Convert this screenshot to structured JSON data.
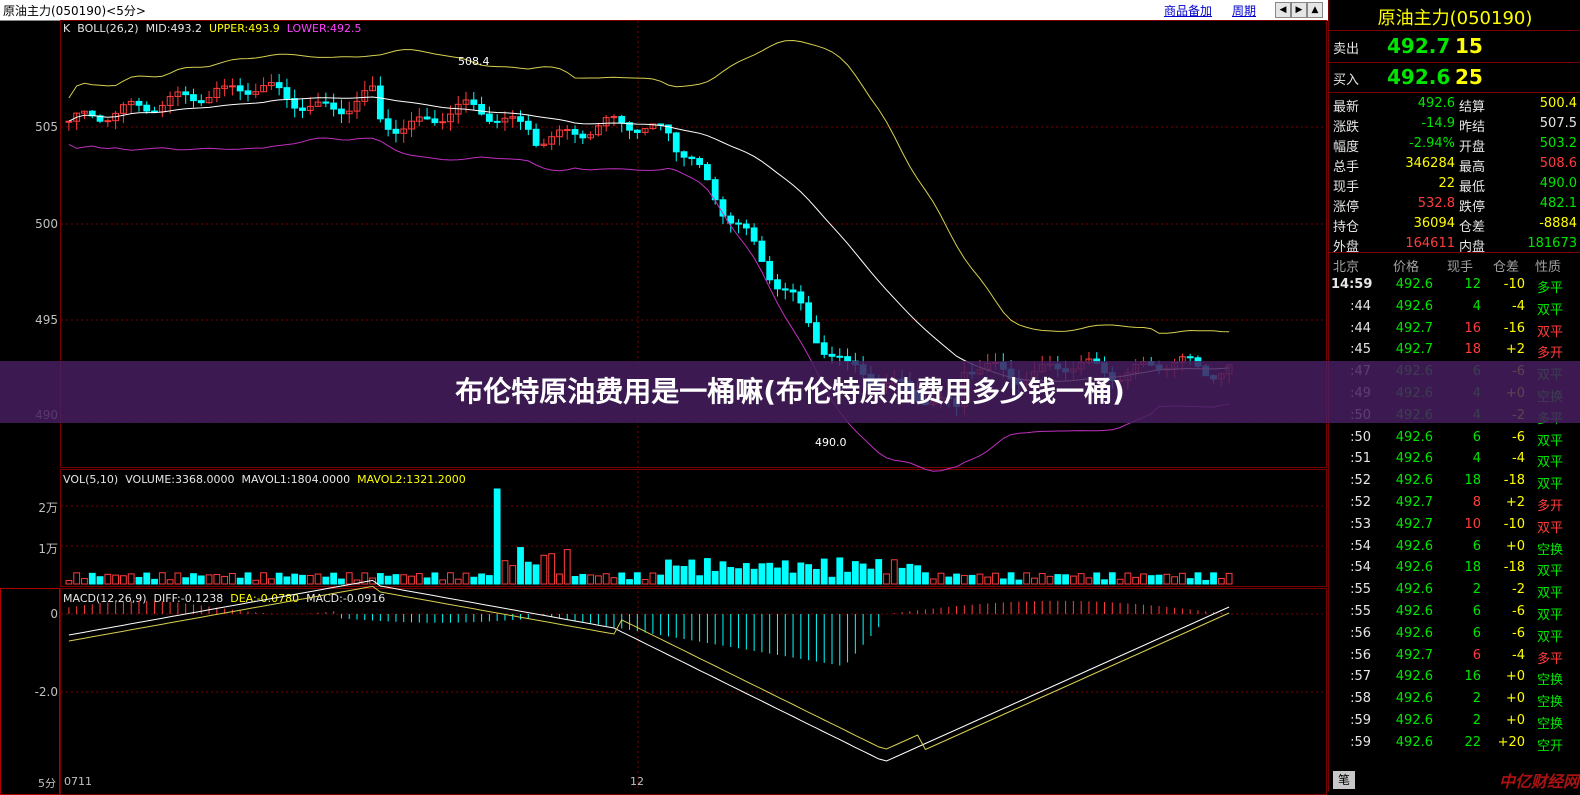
{
  "toolbar": {
    "title": "原油主力(050190)<5分>",
    "link1": "商品备加",
    "link2": "周期",
    "btn_left": "◀",
    "btn_right": "▶",
    "btn_up": "▲",
    "btn_down": "▼"
  },
  "main_chart": {
    "indicator_prefix": "K",
    "boll": "BOLL(26,2)",
    "mid": "MID:493.2",
    "upper": "UPPER:493.9",
    "lower": "LOWER:492.5",
    "y_ticks": [
      "505",
      "500",
      "495",
      "490"
    ],
    "high_marker": "508.4",
    "low_marker": "490.0"
  },
  "volume_chart": {
    "label": "VOL(5,10)",
    "volume": "VOLUME:3368.0000",
    "mavol1": "MAVOL1:1804.0000",
    "mavol2": "MAVOL2:1321.2000",
    "y_ticks": [
      "2万",
      "1万"
    ]
  },
  "macd_chart": {
    "label": "MACD(12,26,9)",
    "diff": "DIFF:-0.1238",
    "dea": "DEA:-0.0780",
    "macd": "MACD:-0.0916",
    "y_ticks": [
      "0",
      "-2.0"
    ]
  },
  "x_axis": {
    "period": "5分",
    "start": "0711",
    "mid": "12"
  },
  "quote": {
    "name": "原油主力(050190)",
    "sell_label": "卖出",
    "sell_price": "492.7",
    "sell_vol": "15",
    "buy_label": "买入",
    "buy_price": "492.6",
    "buy_vol": "25",
    "stats": [
      {
        "l1": "最新",
        "v1": "492.6",
        "c1": "g",
        "l2": "结算",
        "v2": "500.4",
        "c2": "y"
      },
      {
        "l1": "涨跌",
        "v1": "-14.9",
        "c1": "g",
        "l2": "昨结",
        "v2": "507.5",
        "c2": "w"
      },
      {
        "l1": "幅度",
        "v1": "-2.94%",
        "c1": "g",
        "l2": "开盘",
        "v2": "503.2",
        "c2": "g"
      },
      {
        "l1": "总手",
        "v1": "346284",
        "c1": "y",
        "l2": "最高",
        "v2": "508.6",
        "c2": "r"
      },
      {
        "l1": "现手",
        "v1": "22",
        "c1": "y",
        "l2": "最低",
        "v2": "490.0",
        "c2": "g"
      },
      {
        "l1": "涨停",
        "v1": "532.8",
        "c1": "r",
        "l2": "跌停",
        "v2": "482.1",
        "c2": "g"
      },
      {
        "l1": "持仓",
        "v1": "36094",
        "c1": "y",
        "l2": "仓差",
        "v2": "-8884",
        "c2": "y"
      },
      {
        "l1": "外盘",
        "v1": "164611",
        "c1": "r",
        "l2": "内盘",
        "v2": "181673",
        "c2": "g"
      }
    ],
    "tick_header": [
      "北京",
      "价格",
      "现手",
      "仓差",
      "性质"
    ],
    "ticks": [
      {
        "t": "14:59",
        "p": "492.6",
        "pc": "g",
        "v": "12",
        "vc": "g",
        "d": "-10",
        "dc": "y",
        "n": "多平",
        "nc": "g"
      },
      {
        "t": ":44",
        "p": "492.6",
        "pc": "g",
        "v": "4",
        "vc": "g",
        "d": "-4",
        "dc": "y",
        "n": "双平",
        "nc": "g"
      },
      {
        "t": ":44",
        "p": "492.7",
        "pc": "g",
        "v": "16",
        "vc": "r",
        "d": "-16",
        "dc": "y",
        "n": "双平",
        "nc": "r"
      },
      {
        "t": ":45",
        "p": "492.7",
        "pc": "g",
        "v": "18",
        "vc": "r",
        "d": "+2",
        "dc": "y",
        "n": "多开",
        "nc": "r"
      },
      {
        "t": ":47",
        "p": "492.6",
        "pc": "g",
        "v": "6",
        "vc": "g",
        "d": "-6",
        "dc": "y",
        "n": "双平",
        "nc": "g"
      },
      {
        "t": ":49",
        "p": "492.6",
        "pc": "g",
        "v": "4",
        "vc": "g",
        "d": "+0",
        "dc": "y",
        "n": "空换",
        "nc": "g"
      },
      {
        "t": ":50",
        "p": "492.6",
        "pc": "g",
        "v": "4",
        "vc": "g",
        "d": "-2",
        "dc": "y",
        "n": "多平",
        "nc": "g"
      },
      {
        "t": ":50",
        "p": "492.6",
        "pc": "g",
        "v": "6",
        "vc": "g",
        "d": "-6",
        "dc": "y",
        "n": "双平",
        "nc": "g"
      },
      {
        "t": ":51",
        "p": "492.6",
        "pc": "g",
        "v": "4",
        "vc": "g",
        "d": "-4",
        "dc": "y",
        "n": "双平",
        "nc": "g"
      },
      {
        "t": ":52",
        "p": "492.6",
        "pc": "g",
        "v": "18",
        "vc": "g",
        "d": "-18",
        "dc": "y",
        "n": "双平",
        "nc": "g"
      },
      {
        "t": ":52",
        "p": "492.7",
        "pc": "g",
        "v": "8",
        "vc": "r",
        "d": "+2",
        "dc": "y",
        "n": "多开",
        "nc": "r"
      },
      {
        "t": ":53",
        "p": "492.7",
        "pc": "g",
        "v": "10",
        "vc": "r",
        "d": "-10",
        "dc": "y",
        "n": "双平",
        "nc": "r"
      },
      {
        "t": ":54",
        "p": "492.6",
        "pc": "g",
        "v": "6",
        "vc": "g",
        "d": "+0",
        "dc": "y",
        "n": "空换",
        "nc": "g"
      },
      {
        "t": ":54",
        "p": "492.6",
        "pc": "g",
        "v": "18",
        "vc": "g",
        "d": "-18",
        "dc": "y",
        "n": "双平",
        "nc": "g"
      },
      {
        "t": ":55",
        "p": "492.6",
        "pc": "g",
        "v": "2",
        "vc": "g",
        "d": "-2",
        "dc": "y",
        "n": "双平",
        "nc": "g"
      },
      {
        "t": ":55",
        "p": "492.6",
        "pc": "g",
        "v": "6",
        "vc": "g",
        "d": "-6",
        "dc": "y",
        "n": "双平",
        "nc": "g"
      },
      {
        "t": ":56",
        "p": "492.6",
        "pc": "g",
        "v": "6",
        "vc": "g",
        "d": "-6",
        "dc": "y",
        "n": "双平",
        "nc": "g"
      },
      {
        "t": ":56",
        "p": "492.7",
        "pc": "g",
        "v": "6",
        "vc": "r",
        "d": "-4",
        "dc": "y",
        "n": "多平",
        "nc": "r"
      },
      {
        "t": ":57",
        "p": "492.6",
        "pc": "g",
        "v": "16",
        "vc": "g",
        "d": "+0",
        "dc": "y",
        "n": "空换",
        "nc": "g"
      },
      {
        "t": ":58",
        "p": "492.6",
        "pc": "g",
        "v": "2",
        "vc": "g",
        "d": "+0",
        "dc": "y",
        "n": "空换",
        "nc": "g"
      },
      {
        "t": ":59",
        "p": "492.6",
        "pc": "g",
        "v": "2",
        "vc": "g",
        "d": "+0",
        "dc": "y",
        "n": "空换",
        "nc": "g"
      },
      {
        "t": ":59",
        "p": "492.6",
        "pc": "g",
        "v": "22",
        "vc": "g",
        "d": "+20",
        "dc": "y",
        "n": "空开",
        "nc": "g"
      }
    ],
    "footer_tab": "笔",
    "watermark": "中亿财经网"
  },
  "banner": {
    "text": "布伦特原油费用是一桶嘛(布伦特原油费用多少钱一桶)"
  },
  "colors": {
    "up": "#ff3c3c",
    "down": "#00ffff",
    "mid_line": "#ffffff",
    "upper_line": "#d6d050",
    "lower_line": "#c030c0"
  }
}
